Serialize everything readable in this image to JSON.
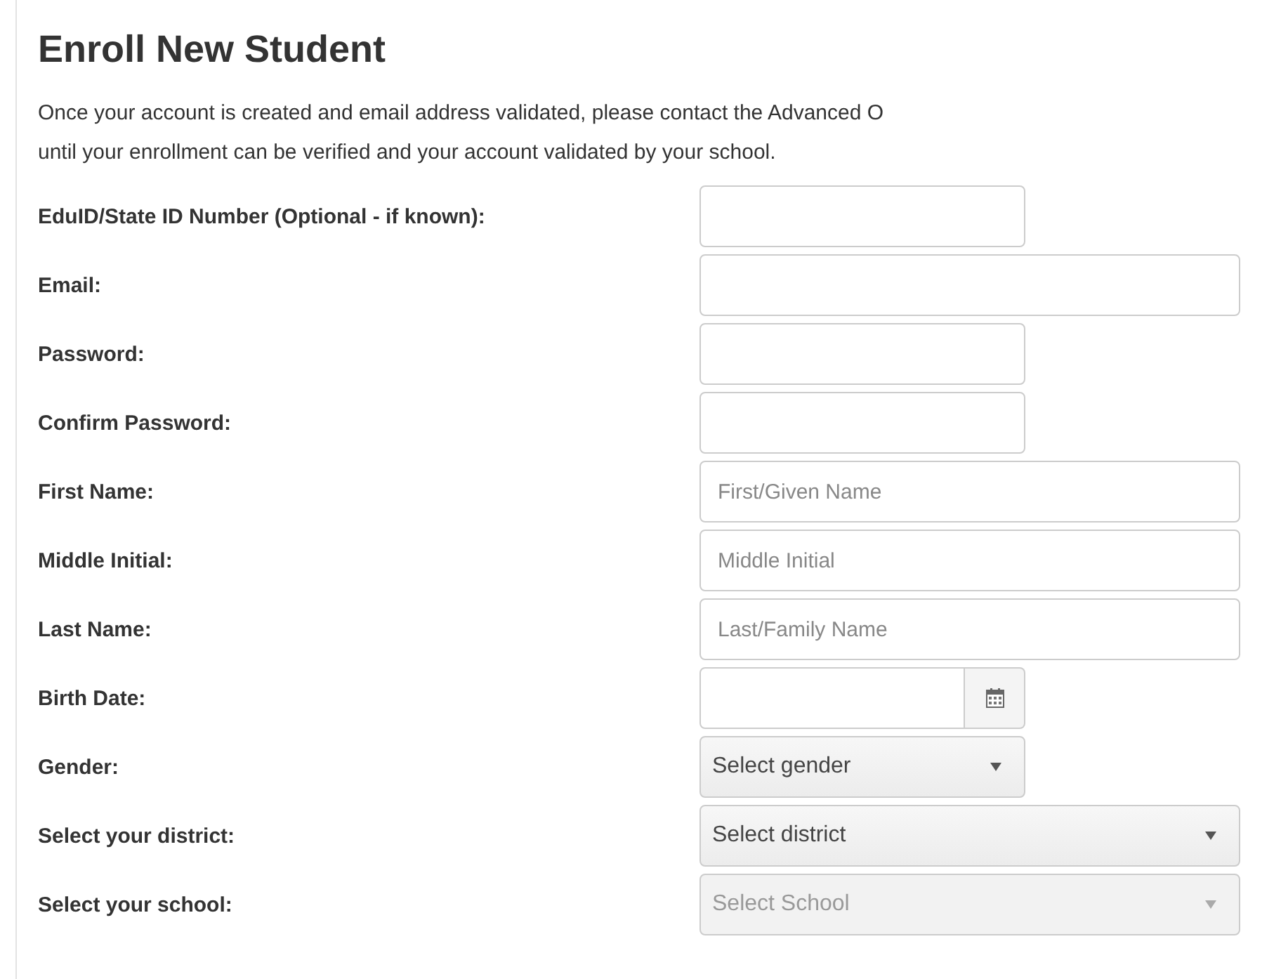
{
  "heading": "Enroll New Student",
  "intro_lines": [
    "Once your account is created and email address validated, please contact the Advanced O",
    "until your enrollment can be verified and your account validated by your school."
  ],
  "fields": [
    {
      "label": "EduID/State ID Number (Optional - if known):",
      "kind": "input"
    },
    {
      "label": "Email:",
      "kind": "input-wide"
    },
    {
      "label": "Password:",
      "kind": "input"
    },
    {
      "label": "Confirm Password:",
      "kind": "input"
    },
    {
      "label": "First Name:",
      "kind": "input-wide",
      "placeholder": "First/Given Name"
    },
    {
      "label": "Middle Initial:",
      "kind": "input-wide",
      "placeholder": "Middle Initial"
    },
    {
      "label": "Last Name:",
      "kind": "input-wide",
      "placeholder": "Last/Family Name"
    },
    {
      "label": "Birth Date:",
      "kind": "date"
    },
    {
      "label": "Gender:",
      "kind": "select",
      "value": "Select gender",
      "disabled": false
    },
    {
      "label": "Select your district:",
      "kind": "select-wide",
      "value": "Select district",
      "disabled": false
    },
    {
      "label": "Select your school:",
      "kind": "select-wide",
      "value": "Select School",
      "disabled": true
    }
  ]
}
